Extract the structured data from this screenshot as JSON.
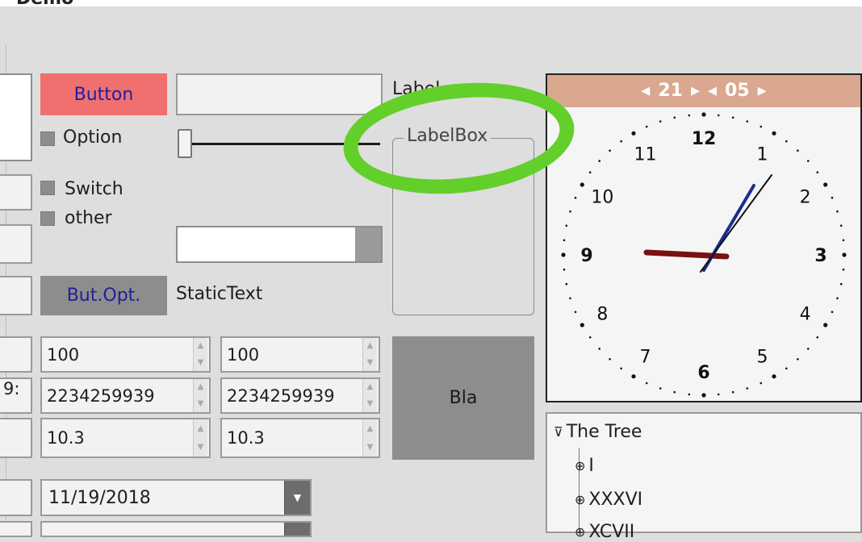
{
  "top": {
    "title": "Demo"
  },
  "left": {
    "button_label": "Button",
    "option_label": "Option",
    "switch_label": "Switch",
    "other_label": "other",
    "but_opt_label": "But.Opt.",
    "static_text": "StaticText"
  },
  "middle": {
    "label_text": "Label",
    "labelbox_title": "LabelBox",
    "spin1": "100",
    "spin2": "100",
    "spin3": "2234259939",
    "spin4": "2234259939",
    "spin5": "10.3",
    "spin6": "10.3",
    "bla_label": "Bla",
    "date_value": "11/19/2018",
    "partial_left_text": "9:"
  },
  "clock": {
    "hour": "21",
    "minute": "05",
    "numbers": [
      "12",
      "1",
      "2",
      "3",
      "4",
      "5",
      "6",
      "7",
      "8",
      "9",
      "10",
      "11"
    ]
  },
  "tree": {
    "root": "The Tree",
    "children": [
      "I",
      "XXXVI",
      "XCVII"
    ]
  },
  "colors": {
    "accent_red": "#f07070",
    "clock_header": "#d9a88f",
    "highlight_ring": "#63cf2a"
  }
}
